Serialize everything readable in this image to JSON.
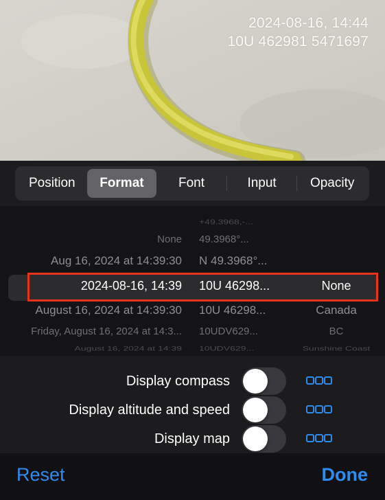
{
  "overlay": {
    "timestamp": "2024-08-16, 14:44",
    "coordinates": "10U 462981 5471697"
  },
  "tabs": [
    {
      "label": "Position",
      "active": false
    },
    {
      "label": "Format",
      "active": true
    },
    {
      "label": "Font",
      "active": false
    },
    {
      "label": "Input",
      "active": false
    },
    {
      "label": "Opacity",
      "active": false
    }
  ],
  "picker": {
    "rows": [
      [
        "",
        "+49.3968,-...",
        ""
      ],
      [
        "None",
        "49.3968°...",
        ""
      ],
      [
        "Aug 16, 2024 at 14:39:30",
        "N 49.3968°...",
        ""
      ],
      [
        "2024-08-16, 14:39",
        "10U 46298...",
        "None"
      ],
      [
        "August 16, 2024 at 14:39:30",
        "10U 46298...",
        "Canada"
      ],
      [
        "Friday, August 16, 2024 at 14:3...",
        "10UDV629...",
        "BC"
      ],
      [
        "August 16, 2024 at 14:39",
        "10UDV629...",
        "Sunshine Coast"
      ]
    ],
    "selected_index": 3
  },
  "toggles": [
    {
      "label": "Display compass",
      "on": false
    },
    {
      "label": "Display altitude and speed",
      "on": false
    },
    {
      "label": "Display map",
      "on": false
    }
  ],
  "footer": {
    "reset_label": "Reset",
    "done_label": "Done"
  },
  "colors": {
    "accent": "#2e8bf0",
    "highlight": "#e8341c",
    "panel": "#1c1c1e"
  },
  "icons": {
    "options": "options-icon"
  }
}
